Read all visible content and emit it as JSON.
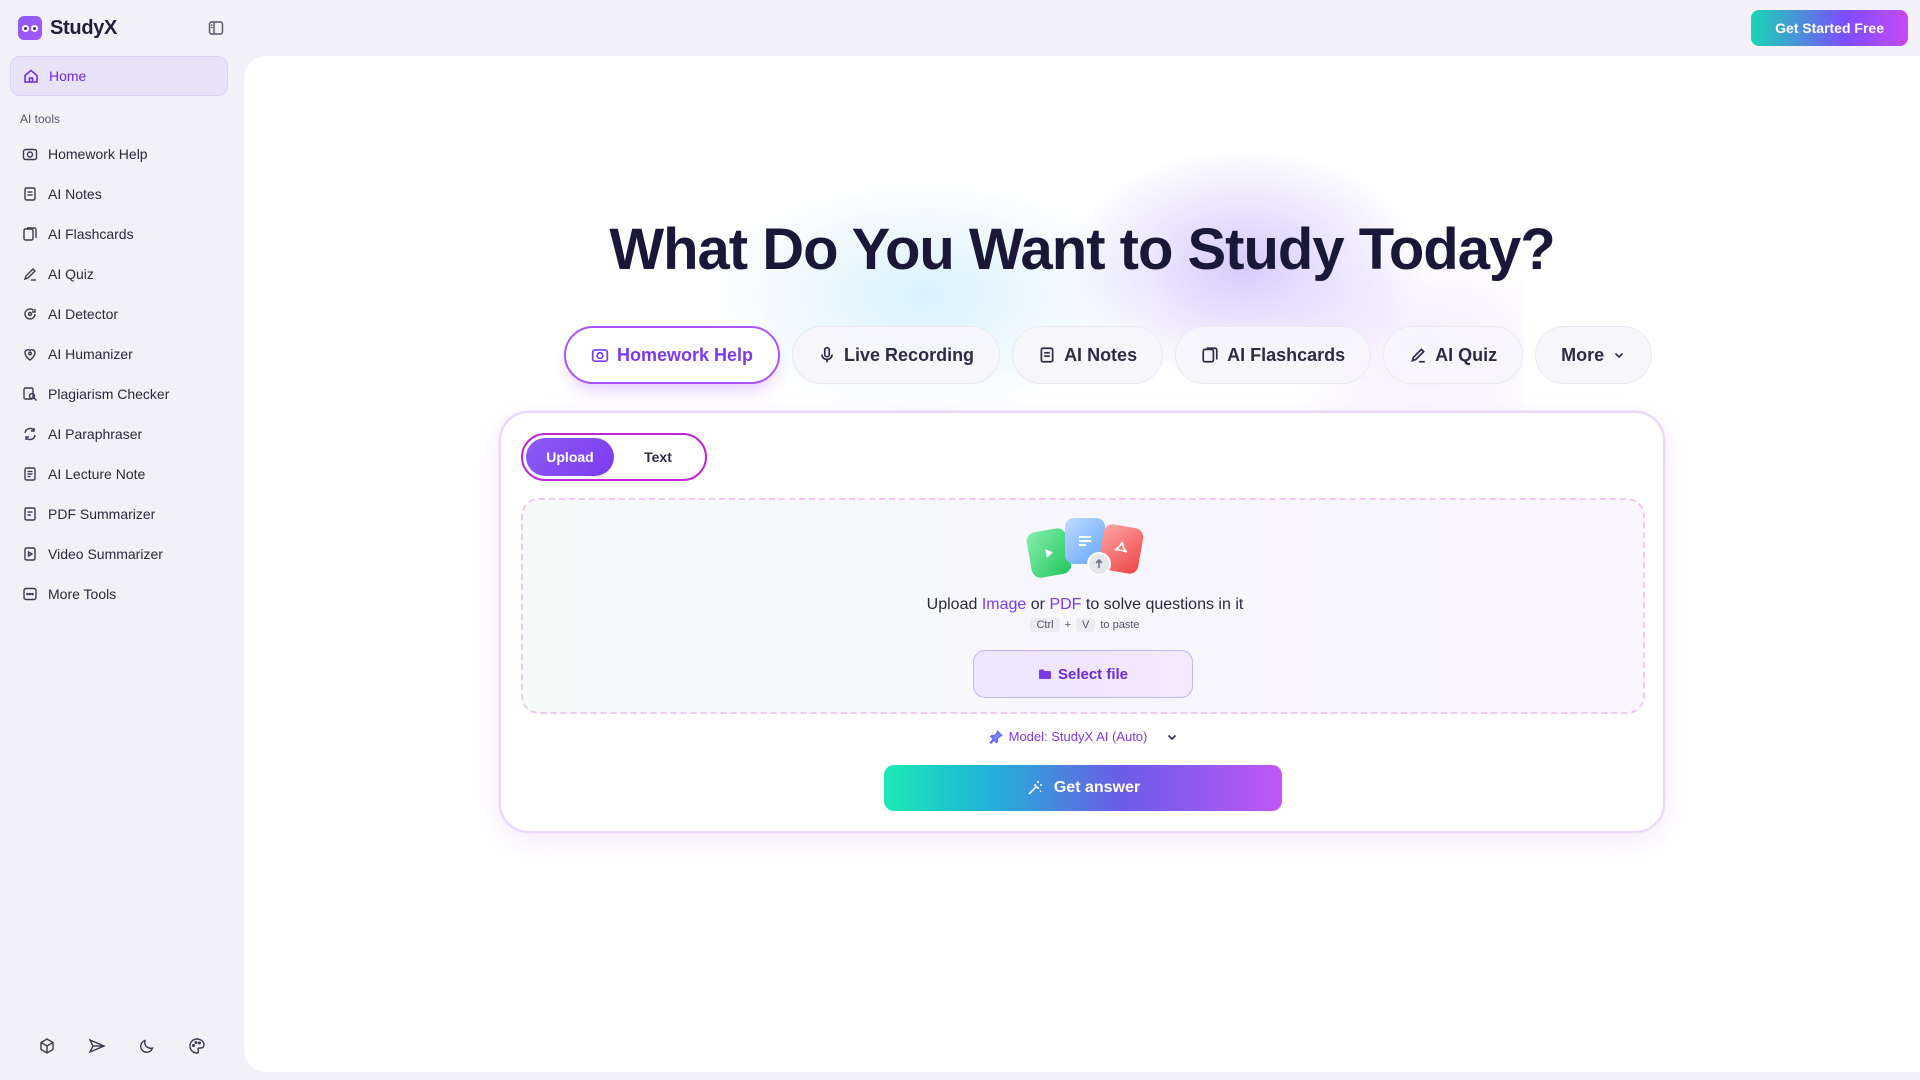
{
  "brand": {
    "name": "StudyX"
  },
  "header": {
    "cta_label": "Get Started Free"
  },
  "sidebar": {
    "home_label": "Home",
    "section_label": "AI tools",
    "items": [
      {
        "label": "Homework Help",
        "icon": "camera-icon"
      },
      {
        "label": "AI Notes",
        "icon": "notes-icon"
      },
      {
        "label": "AI Flashcards",
        "icon": "flashcards-icon"
      },
      {
        "label": "AI Quiz",
        "icon": "quiz-pen-icon"
      },
      {
        "label": "AI Detector",
        "icon": "detector-icon"
      },
      {
        "label": "AI Humanizer",
        "icon": "humanizer-icon"
      },
      {
        "label": "Plagiarism Checker",
        "icon": "plagiarism-icon"
      },
      {
        "label": "AI Paraphraser",
        "icon": "paraphrase-icon"
      },
      {
        "label": "AI Lecture Note",
        "icon": "lecture-note-icon"
      },
      {
        "label": "PDF Summarizer",
        "icon": "pdf-icon"
      },
      {
        "label": "Video Summarizer",
        "icon": "video-icon"
      },
      {
        "label": "More Tools",
        "icon": "more-tools-icon"
      }
    ],
    "footer_icons": [
      "cube-icon",
      "send-icon",
      "moon-icon",
      "palette-icon"
    ]
  },
  "hero": {
    "title": "What Do You Want to Study Today?"
  },
  "tool_tabs": [
    {
      "label": "Homework Help",
      "active": true
    },
    {
      "label": "Live Recording"
    },
    {
      "label": "AI Notes"
    },
    {
      "label": "AI Flashcards"
    },
    {
      "label": "AI Quiz"
    },
    {
      "label": "More"
    }
  ],
  "card": {
    "modes": [
      "Upload",
      "Text"
    ],
    "upload": {
      "prefix": "Upload",
      "image_word": "Image",
      "or_word": "or",
      "pdf_word": "PDF",
      "suffix": "to solve questions in it",
      "key1": "Ctrl",
      "plus": "+",
      "key2": "V",
      "paste_text": "to paste",
      "select_label": "Select file"
    },
    "model_label": "Model: StudyX AI (Auto)",
    "submit_label": "Get answer"
  },
  "colors": {
    "accent": "#7c3aed",
    "active_border": "#a855f7",
    "cta_gradient_start": "#18d6b4",
    "cta_gradient_end": "#c74bf5"
  }
}
